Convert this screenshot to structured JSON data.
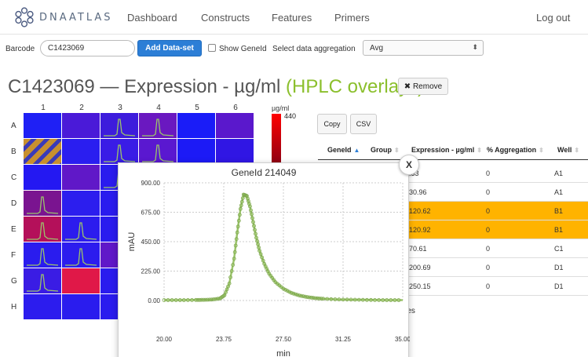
{
  "nav": {
    "brand": "DNAATLAS",
    "links": [
      "Dashboard",
      "Constructs",
      "Features",
      "Primers"
    ],
    "logout": "Log out"
  },
  "toolbar": {
    "barcode_label": "Barcode",
    "barcode_value": "C1423069",
    "add_dataset": "Add Data-set",
    "show_geneid": "Show GeneId",
    "show_geneid_checked": false,
    "aggregation_label": "Select data aggregation",
    "aggregation_value": "Avg"
  },
  "title": {
    "main": "C1423069 — Expression - µg/ml ",
    "accent": "(HPLC overlays)",
    "remove": "✖ Remove"
  },
  "plate": {
    "columns": [
      "1",
      "2",
      "3",
      "4",
      "5",
      "6"
    ],
    "rows": [
      "A",
      "B",
      "C",
      "D",
      "E",
      "F",
      "G",
      "H"
    ],
    "wells": [
      [
        "#1f20f5",
        "#4a1ad8",
        "#3d1cdc",
        "#6a18c0",
        "#1a1cf8",
        "#5a18cc"
      ],
      [
        "hatched",
        "#2a1ef0",
        "#3a1ce6",
        "#5a18d0",
        "#1c1af6",
        "#3016e4"
      ],
      [
        "#2418f2",
        "#6018c8",
        "#2a1cee",
        "#3a1ce4",
        "#1e1af4",
        "#3a1ae2"
      ],
      [
        "#7a1490",
        "#2c1eee",
        "#2a1cee",
        "#3a1ce4",
        "#1e1af4",
        "#3a1ae2"
      ],
      [
        "#b4105a",
        "#2c1cee",
        "#2a1cee",
        "#3a1ce4",
        "#1e1af4",
        "#3a1ae2"
      ],
      [
        "#2a1cee",
        "#2c1cee",
        "#6018c8",
        "#3a1ce4",
        "#1e1af4",
        "#3a1ae2"
      ],
      [
        "#3a1ce4",
        "#e01848",
        "#2a1cee",
        "#3a1ce4",
        "#1e1af4",
        "#3a1ae2"
      ],
      [
        "#2c1cee",
        "#2a1cee",
        "#2a1cee",
        "#3a1ce4",
        "#1e1af4",
        "#3a1ae2"
      ]
    ],
    "peak_wells": [
      "A3",
      "A4",
      "B3",
      "B4",
      "C3",
      "D1",
      "E1",
      "E2",
      "F1",
      "F2",
      "G1"
    ],
    "legend_unit": "µg/ml",
    "legend_max": "440"
  },
  "table": {
    "copy": "Copy",
    "csv": "CSV",
    "headers": [
      "GeneId",
      "Group",
      "Expression - µg/ml",
      "% Aggregation",
      "Well"
    ],
    "rows": [
      {
        "expression": ".33",
        "aggregation": "0",
        "well": "A1",
        "highlight": false
      },
      {
        "expression": "30.96",
        "aggregation": "0",
        "well": "A1",
        "highlight": false
      },
      {
        "expression": "120.62",
        "aggregation": "0",
        "well": "B1",
        "highlight": true
      },
      {
        "expression": "120.92",
        "aggregation": "0",
        "well": "B1",
        "highlight": true
      },
      {
        "expression": "70.61",
        "aggregation": "0",
        "well": "C1",
        "highlight": false
      },
      {
        "expression": "200.69",
        "aggregation": "0",
        "well": "D1",
        "highlight": false
      },
      {
        "expression": "250.15",
        "aggregation": "0",
        "well": "D1",
        "highlight": false
      }
    ],
    "entries_text": "tries"
  },
  "modal": {
    "close": "X"
  },
  "chart_data": {
    "type": "line",
    "title": "GeneId 214049",
    "xlabel": "min",
    "ylabel": "mAU",
    "xlim": [
      20.0,
      35.0
    ],
    "ylim": [
      0,
      900
    ],
    "xticks": [
      "20.00",
      "23.75",
      "27.50",
      "31.25",
      "35.00"
    ],
    "yticks": [
      "0.00",
      "225.00",
      "450.00",
      "675.00",
      "900.00"
    ],
    "grid": true,
    "series": [
      {
        "color": "#9bc46a",
        "x": [
          20.0,
          21.0,
          22.0,
          22.5,
          23.0,
          23.5,
          23.8,
          24.1,
          24.4,
          24.6,
          24.8,
          25.0,
          25.2,
          25.4,
          25.6,
          25.8,
          26.0,
          26.3,
          26.6,
          27.0,
          27.5,
          28.0,
          28.5,
          29.0,
          29.5,
          30.0,
          31.0,
          32.0,
          33.0,
          34.0,
          35.0
        ],
        "y": [
          3,
          3,
          4,
          5,
          7,
          15,
          40,
          130,
          320,
          520,
          700,
          810,
          800,
          720,
          600,
          480,
          380,
          280,
          205,
          140,
          90,
          58,
          38,
          26,
          18,
          13,
          8,
          6,
          4,
          3,
          3
        ]
      }
    ]
  }
}
